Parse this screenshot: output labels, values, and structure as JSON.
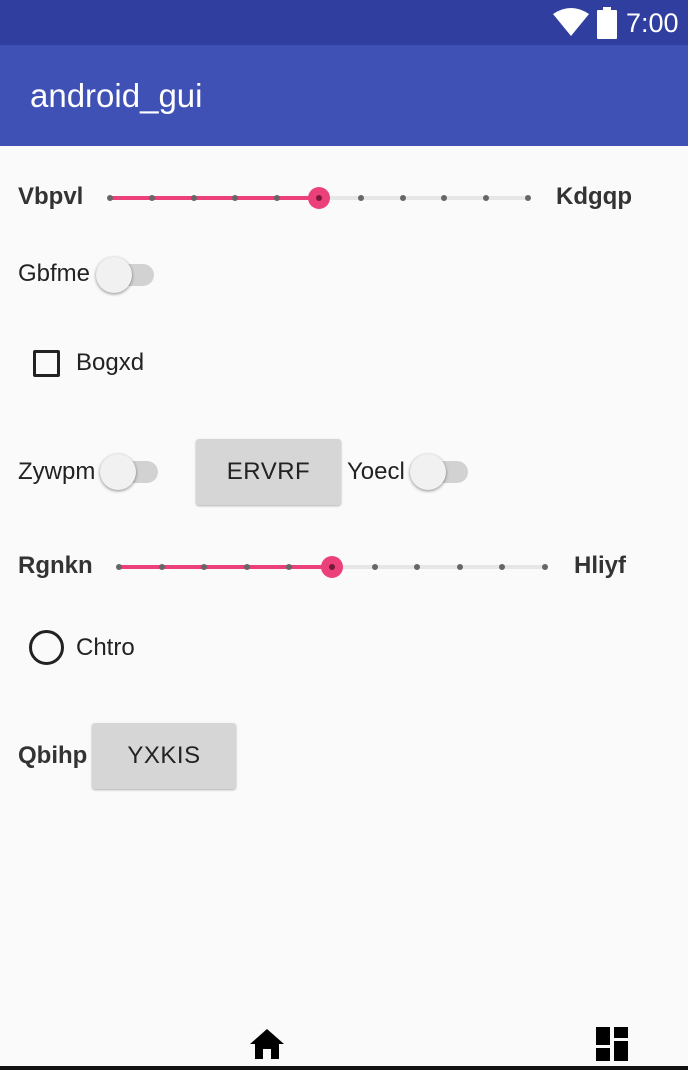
{
  "status_bar": {
    "time": "7:00",
    "icons": [
      "wifi-icon",
      "battery-icon"
    ]
  },
  "app_bar": {
    "title": "android_gui"
  },
  "slider1": {
    "label_left": "Vbpvl",
    "label_right": "Kdgqp",
    "value": 5,
    "max": 10
  },
  "switch1": {
    "label": "Gbfme",
    "checked": false
  },
  "checkbox1": {
    "label": "Bogxd",
    "checked": false
  },
  "switch2": {
    "label": "Zywpm",
    "checked": false
  },
  "button1": {
    "label": "ERVRF"
  },
  "switch3": {
    "label": "Yoecl",
    "checked": false
  },
  "slider2": {
    "label_left": "Rgnkn",
    "label_right": "Hliyf",
    "value": 5,
    "max": 10
  },
  "radio1": {
    "label": "Chtro",
    "checked": false
  },
  "row_last": {
    "label": "Qbihp",
    "button_label": "YXKIS"
  },
  "nav_bar": {
    "icons": [
      "home-icon",
      "recents-icon"
    ]
  },
  "colors": {
    "accent": "#ec407a",
    "primary": "#3f51b5",
    "primary_dark": "#303f9f"
  }
}
